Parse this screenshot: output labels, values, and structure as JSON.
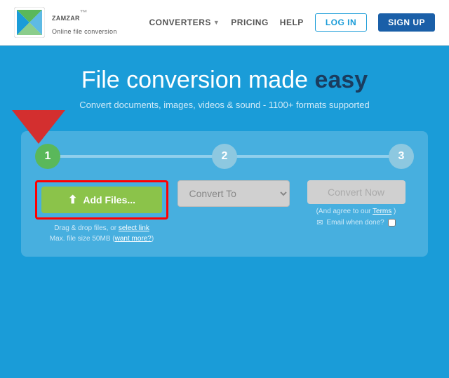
{
  "navbar": {
    "logo_title": "ZAMZAR",
    "logo_tm": "™",
    "logo_subtitle": "Online file conversion",
    "nav_converters": "CONVERTERS",
    "nav_pricing": "PRICING",
    "nav_help": "HELP",
    "btn_login": "LOG IN",
    "btn_signup": "SIGN UP"
  },
  "hero": {
    "title_part1": "File ",
    "title_part2": "conversion made ",
    "title_easy": "easy",
    "subtitle": "Convert documents, images, videos & sound - 1100+ formats supported"
  },
  "widget": {
    "step1_num": "1",
    "step2_num": "2",
    "step3_num": "3",
    "btn_add_files": "Add Files...",
    "drag_text_line1": "Drag & drop files, or",
    "drag_link": "select link",
    "drag_text_line2": "Max. file size 50MB (",
    "drag_want_more": "want more?",
    "drag_text_end": ")",
    "convert_to_placeholder": "Convert To",
    "btn_convert_now": "Convert Now",
    "agree_text": "(And agree to our",
    "terms_link": "Terms",
    "agree_end": ")",
    "email_label": "Email when done?",
    "upload_icon": "⬆"
  }
}
